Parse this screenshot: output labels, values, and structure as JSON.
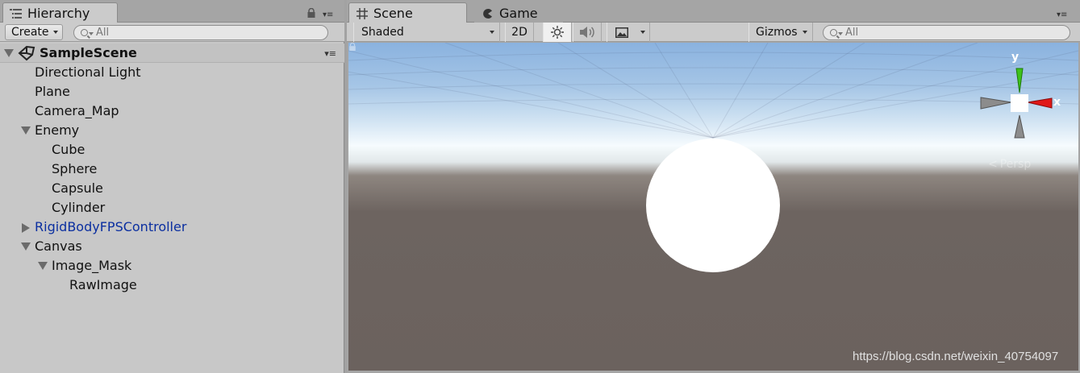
{
  "hierarchy": {
    "tab_label": "Hierarchy",
    "create_label": "Create",
    "search_placeholder": "All",
    "scene_name": "SampleScene",
    "items": [
      {
        "label": "Directional Light"
      },
      {
        "label": "Plane"
      },
      {
        "label": "Camera_Map"
      },
      {
        "label": "Enemy",
        "state": "expanded"
      },
      {
        "label": "Cube"
      },
      {
        "label": "Sphere"
      },
      {
        "label": "Capsule"
      },
      {
        "label": "Cylinder"
      },
      {
        "label": "RigidBodyFPSController",
        "state": "collapsed",
        "prefab": true
      },
      {
        "label": "Canvas",
        "state": "expanded"
      },
      {
        "label": "Image_Mask",
        "state": "expanded"
      },
      {
        "label": "RawImage"
      }
    ]
  },
  "scene": {
    "tabs": [
      {
        "label": "Scene",
        "active": true,
        "icon": "grid-icon"
      },
      {
        "label": "Game",
        "active": false,
        "icon": "pacman-icon"
      }
    ],
    "toolbar": {
      "shading_mode": "Shaded",
      "mode_2d": "2D",
      "lighting_icon": "sun-icon",
      "audio_icon": "speaker-icon",
      "effects_icon": "image-icon",
      "gizmos_label": "Gizmos",
      "search_placeholder": "All"
    },
    "gizmo": {
      "y_label": "y",
      "x_label": "x",
      "projection": "Persp"
    },
    "watermark": "https://blog.csdn.net/weixin_40754097"
  },
  "colors": {
    "prefab_text": "#0b2fa0",
    "gizmo_x": "#e01818",
    "gizmo_y": "#3ec21a",
    "ground": "#6b625e",
    "sky": "#a6c6e6"
  }
}
